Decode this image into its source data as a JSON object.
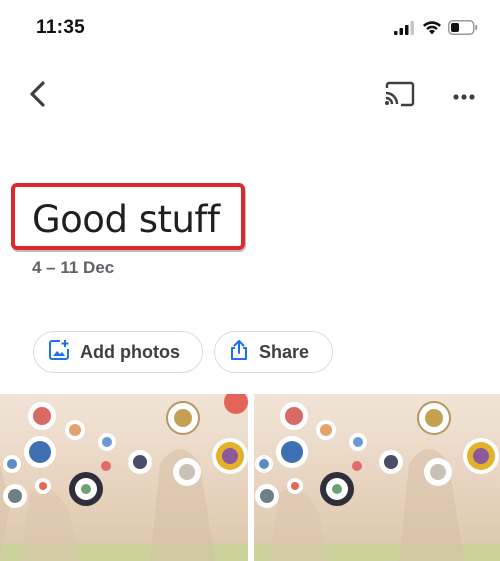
{
  "status_bar": {
    "time": "11:35",
    "icons": [
      "cellular-signal-icon",
      "wifi-icon",
      "battery-icon"
    ]
  },
  "topbar": {
    "icons": [
      "back-arrow-icon",
      "cast-icon",
      "more-options-icon"
    ]
  },
  "album": {
    "title": "Good stuff",
    "date_range": "4 – 11 Dec",
    "highlight_color": "#e3262b"
  },
  "actions": {
    "add_photos_label": "Add photos",
    "share_label": "Share",
    "accent_color": "#1a73e8"
  },
  "photos": [
    {
      "description_icon": "photo-thumbnail"
    },
    {
      "description_icon": "photo-thumbnail"
    }
  ]
}
